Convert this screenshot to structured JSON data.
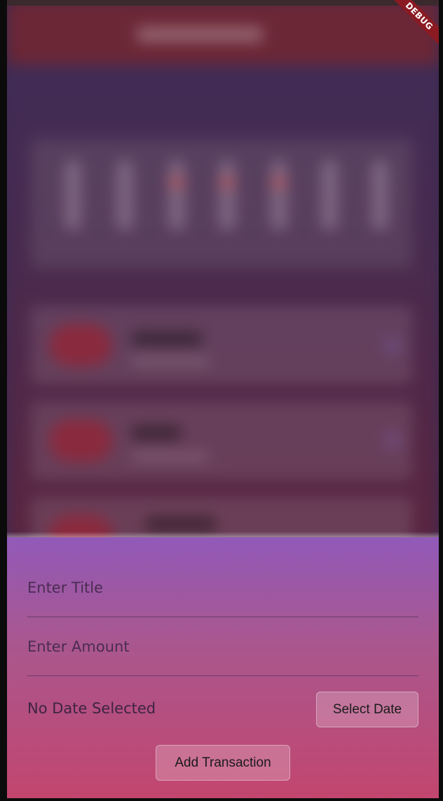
{
  "debug_banner": "DEBUG",
  "form": {
    "title_placeholder": "Enter Title",
    "amount_placeholder": "Enter Amount",
    "date_status": "No Date Selected",
    "select_date_label": "Select Date",
    "submit_label": "Add Transaction"
  },
  "colors": {
    "sheet_top": "#9159b8",
    "sheet_bottom": "#c2466e",
    "appbar": "#6b2736",
    "debug_ribbon": "#8b1a22"
  }
}
